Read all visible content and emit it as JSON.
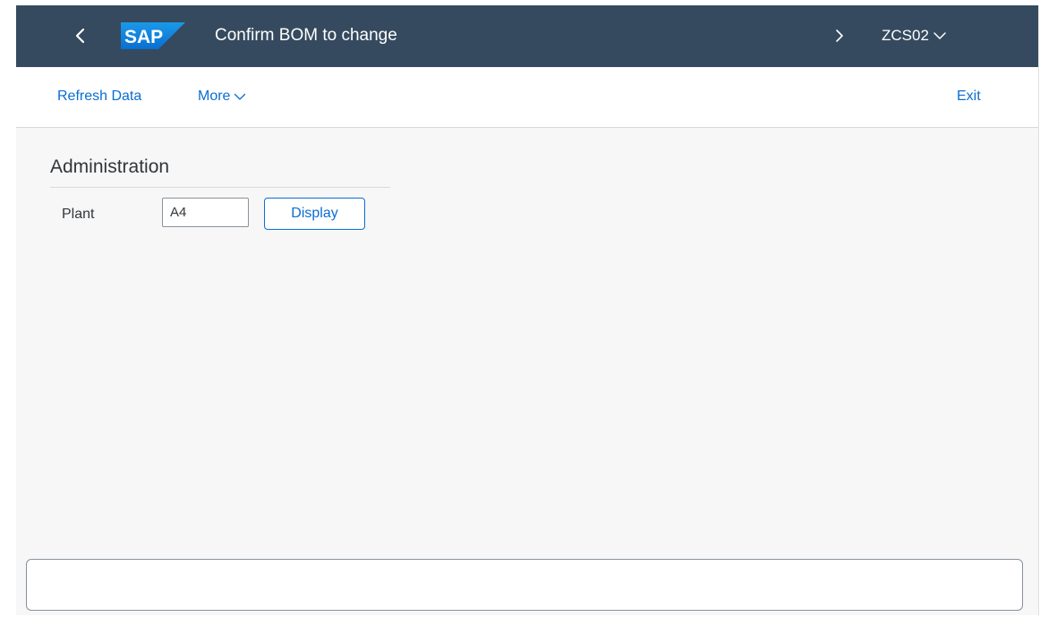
{
  "shell": {
    "title": "Confirm BOM to change",
    "transaction_code": "ZCS02",
    "logo_text": "SAP",
    "icons": {
      "back": "chevron-left-icon",
      "forward": "chevron-right-icon",
      "dropdown": "chevron-down-icon"
    }
  },
  "toolbar": {
    "refresh_label": "Refresh Data",
    "more_label": "More",
    "exit_label": "Exit"
  },
  "section": {
    "title": "Administration"
  },
  "form": {
    "plant_label": "Plant",
    "plant_value": "A4",
    "display_label": "Display"
  },
  "statusbar": {
    "message": ""
  },
  "colors": {
    "shell_bg": "#354a5f",
    "accent": "#0a6ed1",
    "logo_blue": "#0a7ad9",
    "page_bg": "#f7f7f7"
  }
}
